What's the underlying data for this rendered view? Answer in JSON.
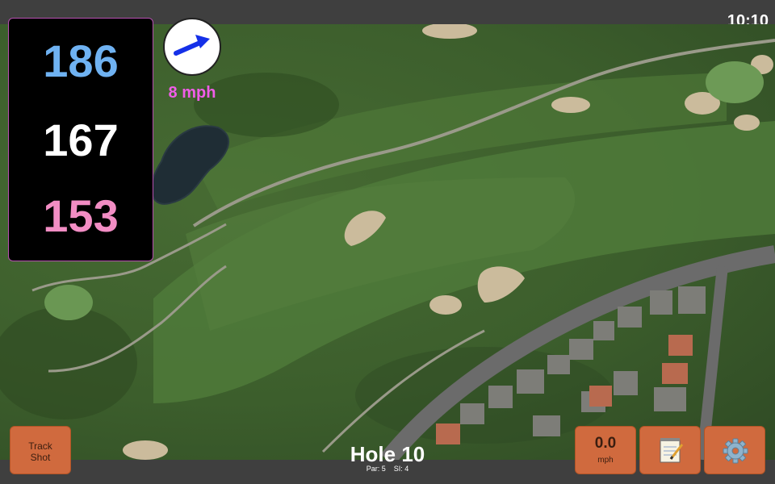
{
  "status_bar": {
    "clock": "10:10"
  },
  "distances": {
    "back": "186",
    "middle": "167",
    "front": "153",
    "colors": {
      "back": "#6fb2f2",
      "middle": "#ffffff",
      "front": "#f28dc4"
    }
  },
  "wind": {
    "speed": "8 mph",
    "arrow_icon": "wind-arrow-icon"
  },
  "buttons": {
    "track_shot_line1": "Track",
    "track_shot_line2": "Shot",
    "speed_value": "0.0",
    "speed_unit": "mph",
    "notes_icon": "notepad-icon",
    "settings_icon": "gear-icon",
    "accent": "#d06a3e"
  },
  "hole": {
    "title": "Hole 10",
    "par_label": "Par:",
    "par_value": "5",
    "si_label": "SI:",
    "si_value": "4"
  }
}
